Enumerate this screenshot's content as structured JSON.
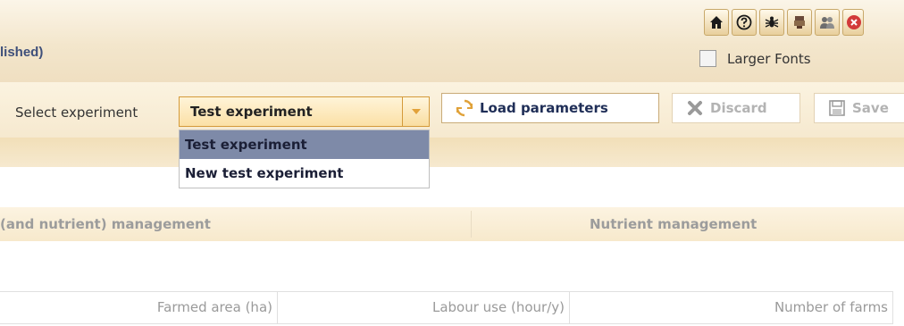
{
  "header": {
    "title": "lished)",
    "toolbar_icons": [
      "home-icon",
      "help-icon",
      "bug-icon",
      "pump-icon",
      "users-icon",
      "close-icon"
    ],
    "larger_fonts": {
      "label": "Larger Fonts",
      "checked": false
    }
  },
  "experiment": {
    "label": "Select experiment",
    "selected": "Test experiment",
    "options": [
      "Test experiment",
      "New test experiment"
    ],
    "highlighted_option": "Test experiment"
  },
  "buttons": {
    "load": "Load parameters",
    "discard": "Discard",
    "save": "Save"
  },
  "section": {
    "left": "(and nutrient) management",
    "right": "Nutrient management"
  },
  "table": {
    "columns": [
      "Farmed area (ha)",
      "Labour use (hour/y)",
      "Number of farms"
    ]
  },
  "colors": {
    "header_bg": "#f3e6cc",
    "title": "#3e4f7a",
    "select_border": "#d49a3a",
    "selected_option": "#7e8aa8",
    "button_text": "#1f2e57"
  }
}
